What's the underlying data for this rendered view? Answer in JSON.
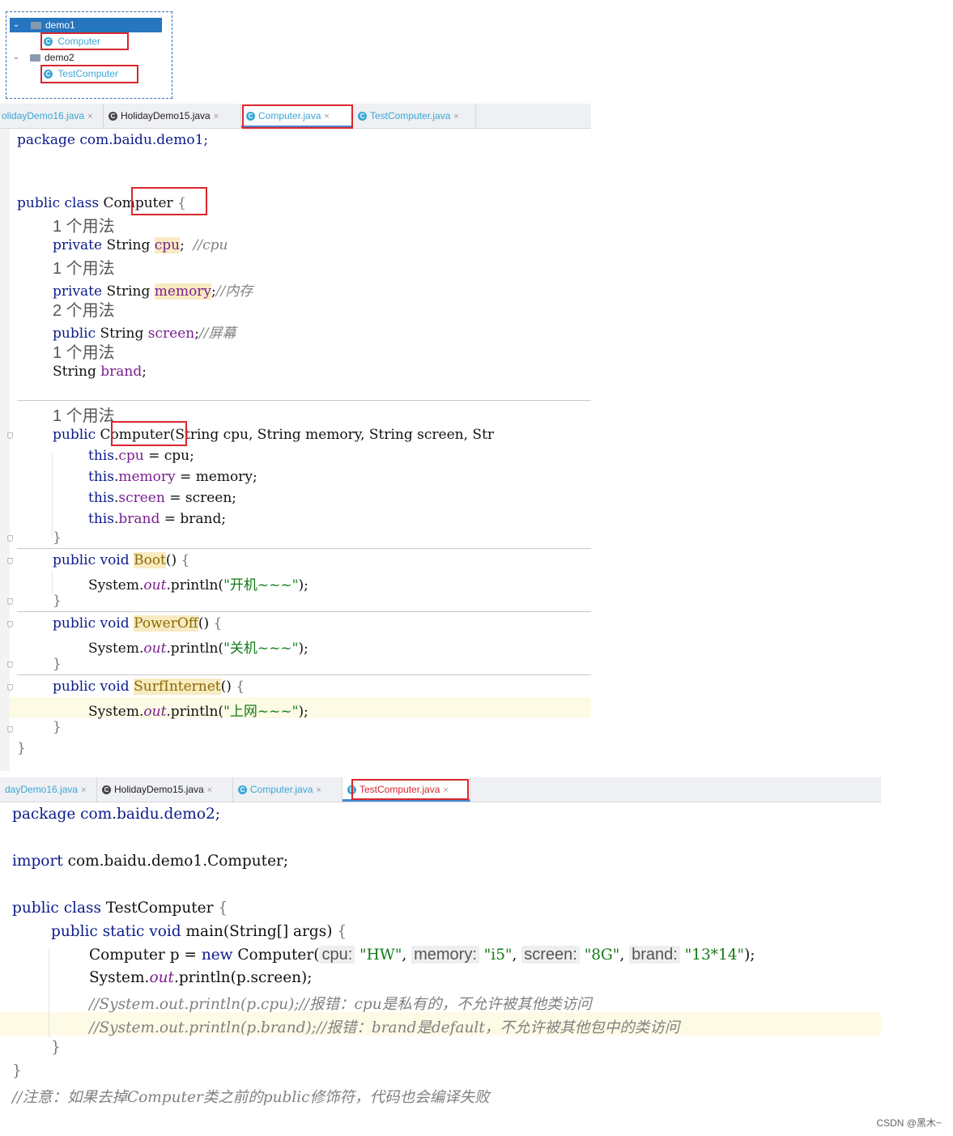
{
  "tree": {
    "items": [
      {
        "label": "demo1",
        "selected": true
      },
      {
        "label": "Computer"
      },
      {
        "label": "demo2"
      },
      {
        "label": "TestComputer"
      }
    ]
  },
  "tabs1": [
    {
      "label": "olidayDemo16.java"
    },
    {
      "label": "HolidayDemo15.java"
    },
    {
      "label": "Computer.java",
      "active": true
    },
    {
      "label": "TestComputer.java"
    }
  ],
  "tabs2": [
    {
      "label": "dayDemo16.java"
    },
    {
      "label": "HolidayDemo15.java"
    },
    {
      "label": "Computer.java"
    },
    {
      "label": "TestComputer.java",
      "active": true
    }
  ],
  "tab_close": "×",
  "class_icon_letter": "C",
  "code1": {
    "package": "package com.baidu.demo1;",
    "usage_1": "1 个用法",
    "usage_2": "2 个用法",
    "kw_public": "public",
    "kw_class": "class",
    "kw_private": "private",
    "kw_void": "void",
    "kw_this": "this",
    "type_string": "String",
    "class_name": "Computer",
    "open_brace": " {",
    "close_brace": "}",
    "f_cpu": "cpu",
    "f_memory": "memory",
    "f_screen": "screen",
    "f_brand": "brand",
    "c_cpu": "//cpu",
    "c_memory": "//内存",
    "c_screen": "//屏幕",
    "ctor_params": "(String cpu, String memory, String screen, Str",
    "assign_cpu": " = cpu;",
    "assign_memory": " = memory;",
    "assign_screen": " = screen;",
    "assign_brand": " = brand;",
    "m_boot": "Boot",
    "m_poweroff": "PowerOff",
    "m_surf": "SurfInternet",
    "parens": "()",
    "sys": "System.",
    "out": "out",
    "println": ".println(",
    "s_boot": "\"开机~~~\"",
    "s_off": "\"关机~~~\"",
    "s_surf": "\"上网~~~\"",
    "end_call": ");"
  },
  "code2": {
    "package": "package com.baidu.demo2;",
    "import_kw": "import",
    "import_path": " com.baidu.demo1.Computer;",
    "kw_public": "public",
    "kw_class": "class",
    "kw_static": "static",
    "kw_void": "void",
    "kw_new": "new",
    "class_name": "TestComputer",
    "open_brace": " {",
    "close_brace": "}",
    "main_sig": "main(String[] args)",
    "var_decl": "Computer p = ",
    "ctor_call": "Computer(",
    "h_cpu": "cpu:",
    "h_memory": "memory:",
    "h_screen": "screen:",
    "h_brand": "brand:",
    "v_cpu": "\"HW\"",
    "v_memory": "\"i5\"",
    "v_screen": "\"8G\"",
    "v_brand": "\"13*14\"",
    "comma": ", ",
    "end_call": ");",
    "sys": "System.",
    "out": "out",
    "print_tail": ".println(p.screen);",
    "comment1": "//System.out.println(p.cpu);//报错：cpu是私有的，不允许被其他类访问",
    "comment2": "//System.out.println(p.brand);//报错：brand是default，不允许被其他包中的类访问",
    "comment3": "//注意：如果去掉Computer类之前的public修饰符，代码也会编译失败"
  },
  "watermark": "CSDN @黑木~",
  "colors": {
    "accent": "#2675bf",
    "highlight": "#d9262c"
  }
}
